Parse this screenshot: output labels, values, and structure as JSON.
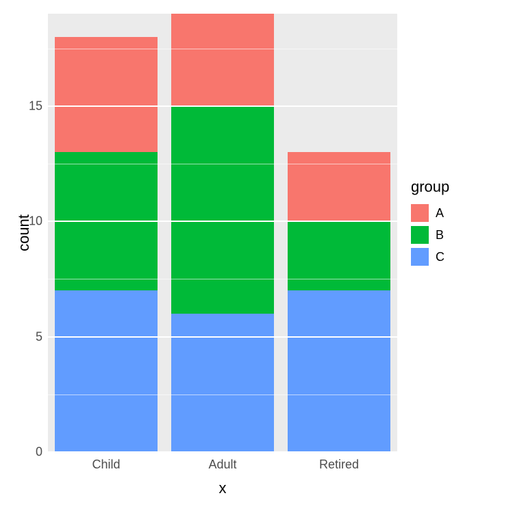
{
  "chart_data": {
    "type": "bar",
    "stacked": true,
    "categories": [
      "Child",
      "Adult",
      "Retired"
    ],
    "series": [
      {
        "name": "A",
        "values": [
          5,
          4,
          3
        ],
        "color": "#F8766D"
      },
      {
        "name": "B",
        "values": [
          6,
          9,
          3
        ],
        "color": "#00BA38"
      },
      {
        "name": "C",
        "values": [
          7,
          6,
          7
        ],
        "color": "#619CFF"
      }
    ],
    "xlabel": "x",
    "ylabel": "count",
    "yticks": [
      0,
      5,
      10,
      15
    ],
    "ylim": [
      0,
      19
    ],
    "legend_title": "group"
  }
}
